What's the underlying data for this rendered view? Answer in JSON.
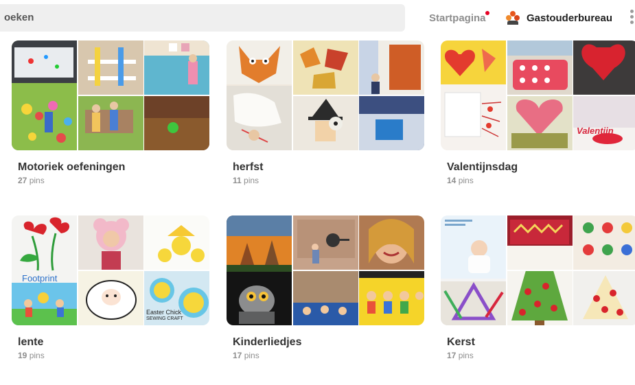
{
  "header": {
    "search_text": "oeken",
    "home_label": "Startpagina",
    "profile_name": "Gastouderbureau"
  },
  "boards": [
    {
      "title": "Motoriek oefeningen",
      "count": "27",
      "unit": "pins"
    },
    {
      "title": "herfst",
      "count": "11",
      "unit": "pins"
    },
    {
      "title": "Valentijnsdag",
      "count": "14",
      "unit": "pins"
    },
    {
      "title": "lente",
      "count": "19",
      "unit": "pins"
    },
    {
      "title": "Kinderliedjes",
      "count": "17",
      "unit": "pins"
    },
    {
      "title": "Kerst",
      "count": "17",
      "unit": "pins"
    }
  ],
  "board_texts": {
    "lente_footprint": "Footprint",
    "lente_easter": "Easter Chick",
    "lente_sewing": "SEWING CRAFT",
    "valentijn": "Valentijn"
  },
  "colors": {
    "notification": "#e60023",
    "muted": "#8e8e8e",
    "search_bg": "#efefef"
  }
}
